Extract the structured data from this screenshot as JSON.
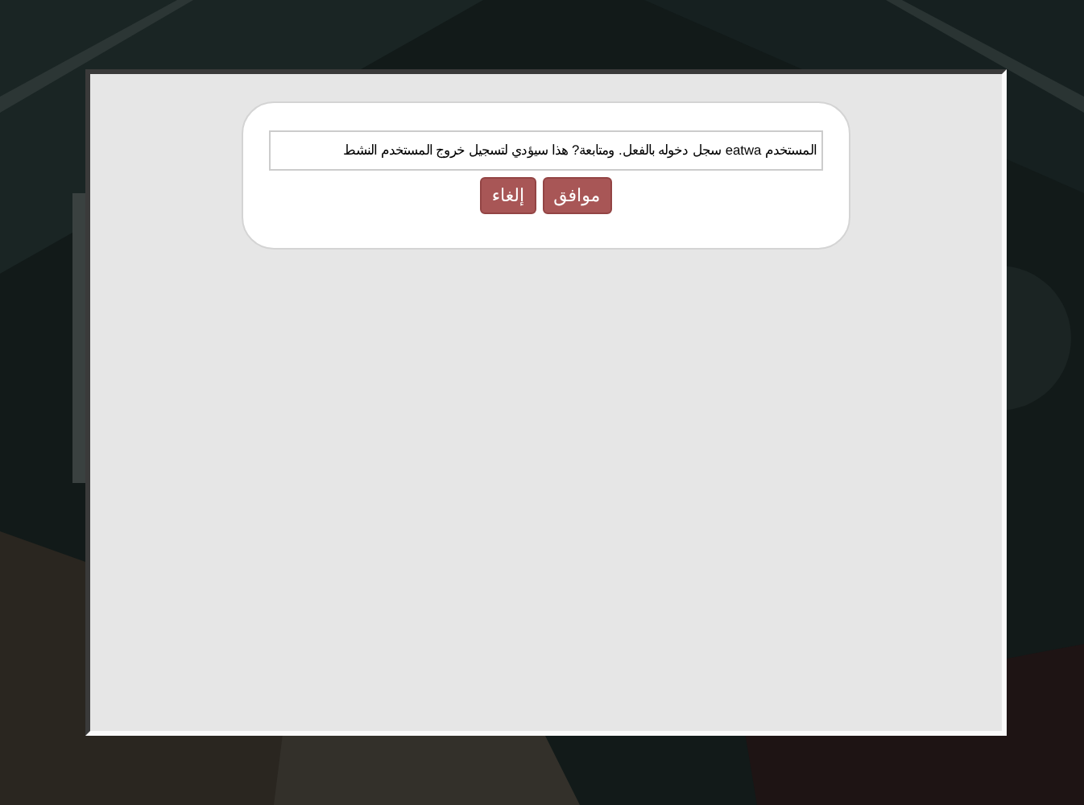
{
  "dialog": {
    "message": "المستخدم eatwa سجل دخوله بالفعل. ومتابعة? هذا سيؤدي لتسجيل خروج المستخدم النشط",
    "buttons": [
      {
        "label": "موافق"
      },
      {
        "label": "إلغاء"
      }
    ]
  }
}
